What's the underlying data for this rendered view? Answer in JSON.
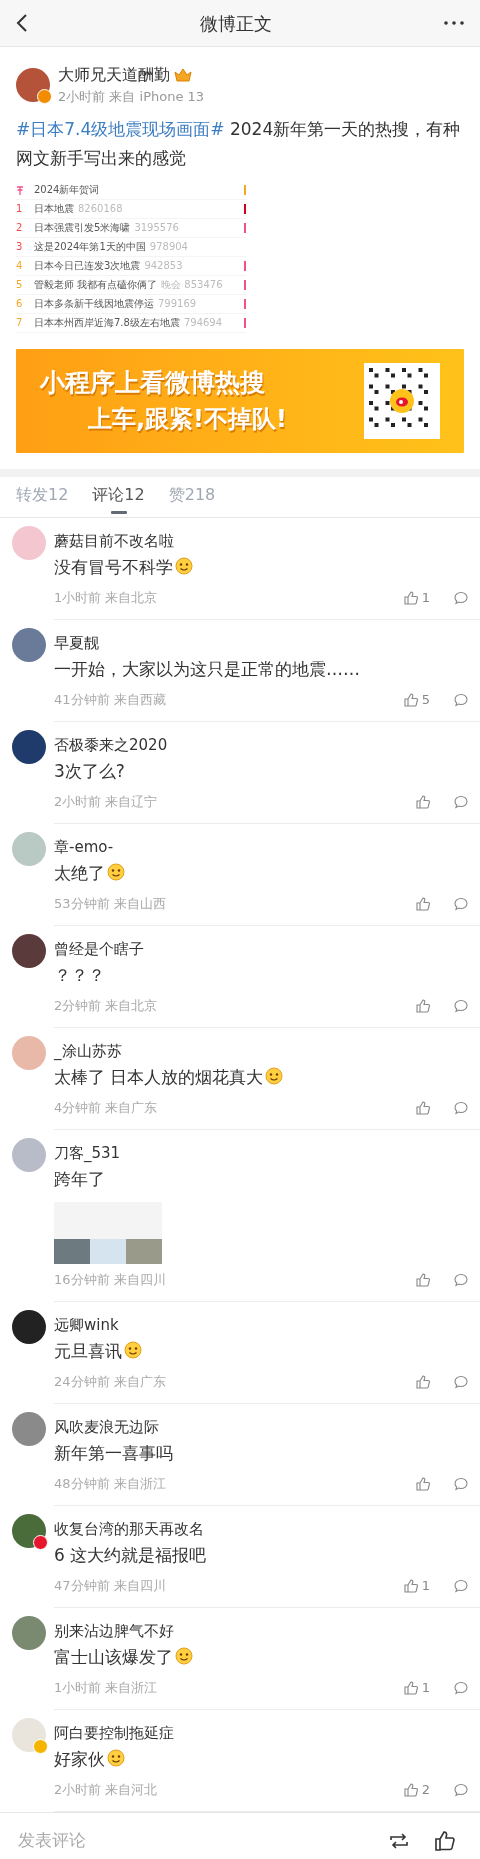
{
  "header": {
    "title": "微博正文"
  },
  "post": {
    "author": "大师兄天道酬勤",
    "verified": true,
    "meta": "2小时前 来自 iPhone 13",
    "topic": "#日本7.4级地震现场画面#",
    "text": " 2024新年第一天的热搜，有种网文新手写出来的感觉",
    "hot_list": [
      {
        "title": "2024新年贺词",
        "pinned": true,
        "color": "#f5a623"
      },
      {
        "rank": "1",
        "title": "日本地震",
        "count": "8260168",
        "pinned": false,
        "color": "#d0021b"
      },
      {
        "rank": "2",
        "title": "日本强震引发5米海啸",
        "count": "3195576",
        "pinned": false,
        "color": "#f2508a"
      },
      {
        "rank": "3",
        "title": "这是2024年第1天的中国",
        "count": "978904",
        "pinned": false
      },
      {
        "rank": "4",
        "title": "日本今日已连发3次地震",
        "count": "942853",
        "pinned": false,
        "color": "#f2508a"
      },
      {
        "rank": "5",
        "title": "管毅老师 我都有点磕你俩了",
        "count": "晚会 853476",
        "pinned": false,
        "color": "#f2508a"
      },
      {
        "rank": "6",
        "title": "日本多条新干线因地震停运",
        "count": "799169",
        "pinned": false,
        "color": "#f2508a"
      },
      {
        "rank": "7",
        "title": "日本本州西岸近海7.8级左右地震",
        "count": "794694",
        "pinned": false,
        "color": "#f2508a"
      }
    ],
    "banner": {
      "line1": "小程序上看微博热搜",
      "line2": "上车,跟紧!不掉队!"
    }
  },
  "tabs": [
    {
      "label": "转发12",
      "selected": false
    },
    {
      "label": "评论12",
      "selected": true
    },
    {
      "label": "赞218",
      "selected": false
    }
  ],
  "comments": [
    {
      "name": "蘑菇目前不改名啦",
      "text": "没有冒号不科学",
      "emoji": true,
      "time": "1小时前 来自北京",
      "likes": "1",
      "color": "#f4c6d0"
    },
    {
      "name": "早夏靓",
      "text": "一开始，大家以为这只是正常的地震……",
      "emoji": false,
      "time": "41分钟前 来自西藏",
      "likes": "5",
      "color": "#6a7a99"
    },
    {
      "name": "否极黍来之2020",
      "text": "3次了么?",
      "emoji": false,
      "time": "2小时前 来自辽宁",
      "color": "#1f3b6b"
    },
    {
      "name": "章-emo-",
      "text": "太绝了",
      "emoji": true,
      "time": "53分钟前 来自山西",
      "color": "#b9c9c4"
    },
    {
      "name": "曾经是个瞎子",
      "text": "？？？",
      "emoji": false,
      "time": "2分钟前 来自北京",
      "color": "#5a3a3a"
    },
    {
      "name": "_涂山苏苏",
      "text": "太棒了 日本人放的烟花真大",
      "emoji": true,
      "time": "4分钟前 来自广东",
      "color": "#e8b9a8"
    },
    {
      "name": "刀客_531",
      "text": "跨年了",
      "emoji": false,
      "time": "16分钟前 来自四川",
      "photos": true,
      "color": "#b8bcc8"
    },
    {
      "name": "远卿wink",
      "text": "元旦喜讯",
      "emoji": true,
      "time": "24分钟前 来自广东",
      "color": "#222222"
    },
    {
      "name": "风吹麦浪无边际",
      "text": "新年第一喜事吗",
      "emoji": false,
      "time": "48分钟前 来自浙江",
      "color": "#8a8a8a"
    },
    {
      "name": "收复台湾的那天再改名",
      "text": "6 这大约就是福报吧",
      "emoji": false,
      "time": "47分钟前 来自四川",
      "likes": "1",
      "badge": {
        "color": "#e6162d"
      },
      "color": "#4a6b3a"
    },
    {
      "name": "别来沾边脾气不好",
      "text": "富士山该爆发了",
      "emoji": true,
      "time": "1小时前 来自浙江",
      "likes": "1",
      "color": "#7a8a70"
    },
    {
      "name": "阿白要控制拖延症",
      "text": "好家伙",
      "emoji": true,
      "time": "2小时前 来自河北",
      "likes": "2",
      "badge": {
        "color": "#f5b400"
      },
      "color": "#e9e4dc"
    }
  ],
  "footer": {
    "placeholder": "发表评论"
  }
}
